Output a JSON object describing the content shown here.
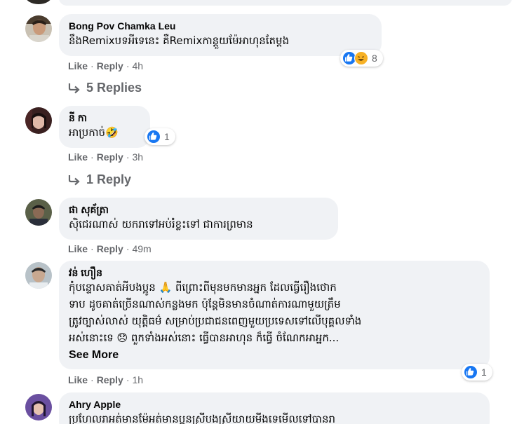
{
  "comments": [
    {
      "author": "Bong Pov Chamka Leu",
      "text": "នឹងRemixបទអីទេនេះ គឺRemixកាន្តួយម៉ែអាហុនតែម្តង",
      "reaction_count": "8",
      "actions": {
        "like": "Like",
        "reply": "Reply",
        "time": "4h"
      },
      "replies": "5 Replies"
    },
    {
      "author": "នី កា",
      "text": "អាប្រកាច់🤣",
      "reaction_count": "1",
      "actions": {
        "like": "Like",
        "reply": "Reply",
        "time": "3h"
      },
      "replies": "1 Reply"
    },
    {
      "author": "ផា សុគ័ត្រា",
      "text": "ស៊ិជេរណាស់ យករាទៅអប់រំខ្លះទៅ ជាការព្រមាន",
      "actions": {
        "like": "Like",
        "reply": "Reply",
        "time": "49m"
      }
    },
    {
      "author": "វន់ ហឿន",
      "lines": [
        "កុំបន្ទោសគាត់អីបងប្អូន 🙏 ពីព្រោះពីមុនមកមានអ្នក ដែលធ្វើរឿងថោក",
        "ទាប ដូចគាត់ច្រើនណាស់កន្លងមក ប៉ុន្តែមិនមានចំណាត់ការណាមួយត្រឹម",
        "ត្រូវច្បាស់លាស់ យុត្តិធម៌ សម្រាប់ប្រជាជនពេញមួយប្រទេសទៅលើបុគ្គលទាំង",
        "អស់នោះទេ 😞 ពួកទាំងអស់នោះ ធ្វើបានអាហុន ក៏ធ្វើ ចំណែកអាអ្នក..."
      ],
      "see_more": "See More",
      "reaction_count": "1",
      "actions": {
        "like": "Like",
        "reply": "Reply",
        "time": "1h"
      }
    },
    {
      "author": "Ahry Apple",
      "text": "ប្រហែលរាអត់មានម៉ែអត់មានប្អូនស្រីបងស្រីយាយមីងទេមើលទៅបានរា"
    }
  ],
  "colors": {
    "bubble": "#f0f2f5",
    "meta": "#65676b",
    "like_blue": "#1877f2",
    "haha_yellow": "#f7b125"
  }
}
